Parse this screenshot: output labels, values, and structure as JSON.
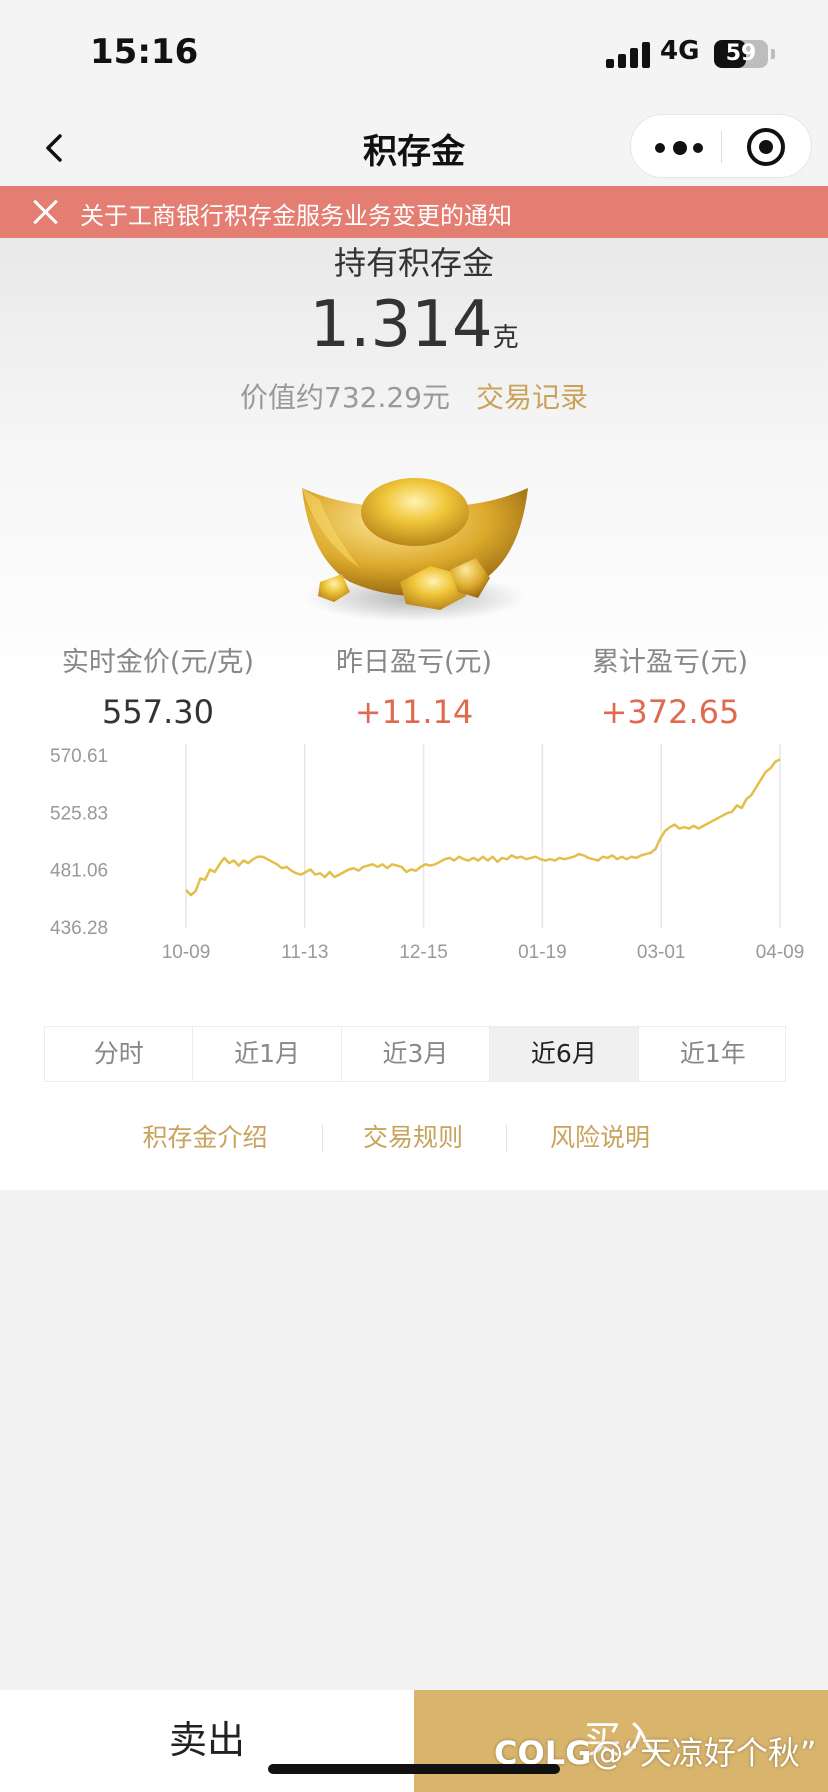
{
  "status_bar": {
    "time": "15:16",
    "network": "4G",
    "battery": "59",
    "battery_level": 0.59
  },
  "nav": {
    "title": "积存金"
  },
  "notice": {
    "text": "关于工商银行积存金服务业务变更的通知"
  },
  "holding": {
    "title": "持有积存金",
    "grams": "1.314",
    "unit": "克",
    "value_text": "价值约732.29元",
    "record_link": "交易记录"
  },
  "stats": [
    {
      "label": "实时金价(元/克)",
      "value": "557.30"
    },
    {
      "label": "昨日盈亏(元)",
      "value": "+11.14"
    },
    {
      "label": "累计盈亏(元)",
      "value": "+372.65"
    }
  ],
  "chart_data": {
    "type": "line",
    "y_ticks": [
      "570.61",
      "525.83",
      "481.06",
      "436.28"
    ],
    "x_ticks": [
      "10-09",
      "11-13",
      "12-15",
      "01-19",
      "03-01",
      "04-09"
    ],
    "ylim": [
      436.28,
      570.61
    ],
    "grid": "vertical",
    "line_color": "#e3bf4a",
    "series": [
      {
        "values": [
          466,
          462,
          465,
          475,
          474,
          482,
          480,
          486,
          491,
          487,
          489,
          485,
          489,
          487,
          490,
          492,
          492,
          490,
          488,
          486,
          483,
          484,
          481,
          479,
          478,
          480,
          482,
          478,
          479,
          476,
          480,
          476,
          478,
          480,
          482,
          483,
          481,
          484,
          485,
          486,
          484,
          486,
          483,
          486,
          485,
          484,
          480,
          482,
          481,
          484,
          486,
          485,
          486,
          488,
          490,
          491,
          489,
          492,
          490,
          489,
          491,
          489,
          492,
          489,
          492,
          488,
          491,
          490,
          493,
          491,
          492,
          490,
          491,
          492,
          490,
          489,
          490,
          489,
          491,
          490,
          491,
          492,
          494,
          493,
          491,
          490,
          489,
          492,
          491,
          493,
          490,
          492,
          490,
          492,
          491,
          493,
          494,
          495,
          498,
          506,
          512,
          515,
          517,
          514,
          515,
          514,
          516,
          514,
          516,
          518,
          520,
          522,
          524,
          526,
          527,
          532,
          530,
          537,
          540,
          546,
          552,
          558,
          561,
          566,
          568
        ]
      }
    ]
  },
  "range_tabs": [
    "分时",
    "近1月",
    "近3月",
    "近6月",
    "近1年"
  ],
  "range_active": "近6月",
  "info_links": [
    "积存金介绍",
    "交易规则",
    "风险说明"
  ],
  "bottom": {
    "sell": "卖出",
    "buy": "买入"
  },
  "watermark": {
    "brand": "COLG",
    "handle": "@“天凉好个秋”"
  }
}
